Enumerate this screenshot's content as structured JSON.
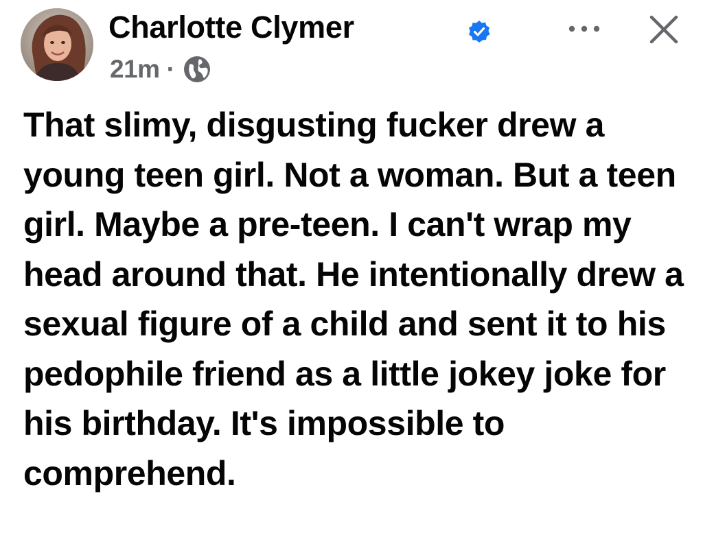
{
  "post": {
    "author": {
      "name": "Charlotte Clymer",
      "verified": true,
      "verified_icon": "verified-badge-icon",
      "avatar_icon": "avatar"
    },
    "meta": {
      "time": "21m",
      "separator": "·",
      "audience_icon": "globe-icon"
    },
    "actions": {
      "more_icon": "more-options-icon",
      "close_icon": "close-icon"
    },
    "body": "That slimy, disgusting fucker drew a young teen girl. Not a woman. But a teen girl. Maybe a pre-teen. I can't wrap my head around that. He intentionally drew a sexual figure of a child and sent it to his pedophile friend as a little jokey joke for his birthday. It's impossible to comprehend."
  },
  "colors": {
    "text_primary": "#050505",
    "text_secondary": "#65676b",
    "verified_blue": "#1877f2",
    "background": "#ffffff"
  }
}
